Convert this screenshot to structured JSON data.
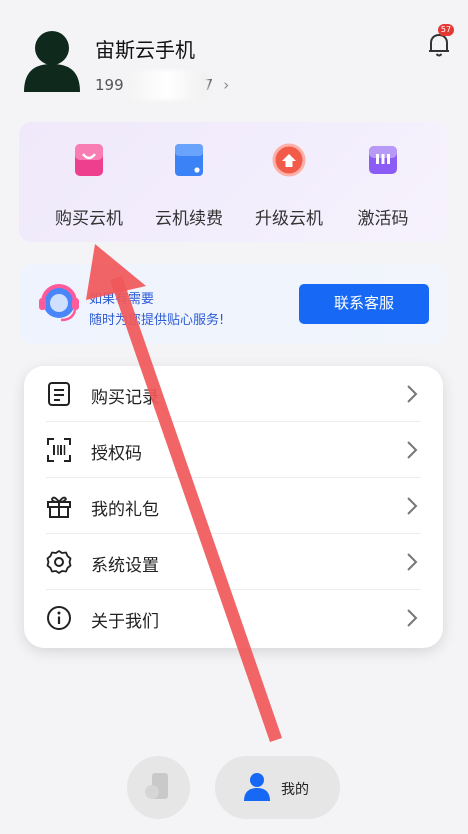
{
  "profile": {
    "username": "宙斯云手机",
    "phone_prefix": "199",
    "phone_suffix": "7",
    "notification_count": "57"
  },
  "quick_actions": [
    {
      "label": "购买云机",
      "icon": "shopping-bag-icon"
    },
    {
      "label": "云机续费",
      "icon": "renew-card-icon"
    },
    {
      "label": "升级云机",
      "icon": "upgrade-icon"
    },
    {
      "label": "激活码",
      "icon": "activation-code-icon"
    }
  ],
  "service": {
    "line1": "如果有需要",
    "line2": "随时为您提供贴心服务!",
    "button_label": "联系客服"
  },
  "menu": [
    {
      "label": "购买记录",
      "icon": "document-list-icon"
    },
    {
      "label": "授权码",
      "icon": "scan-code-icon"
    },
    {
      "label": "我的礼包",
      "icon": "gift-icon"
    },
    {
      "label": "系统设置",
      "icon": "gear-icon"
    },
    {
      "label": "关于我们",
      "icon": "info-icon"
    }
  ],
  "tabbar": {
    "mine_label": "我的"
  },
  "colors": {
    "accent": "#1769f5",
    "annotation_arrow": "#f0585a",
    "badge": "#e53935"
  }
}
